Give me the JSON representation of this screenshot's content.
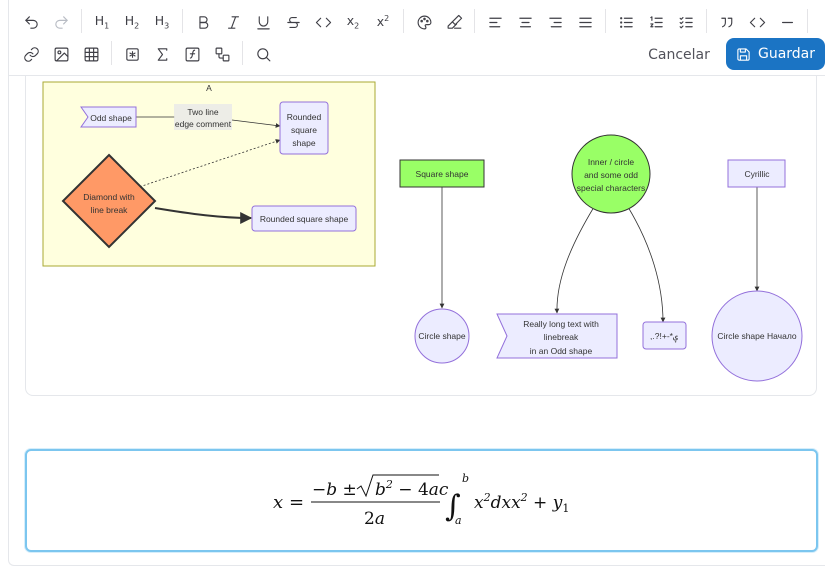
{
  "toolbar": {
    "row1": [
      {
        "name": "undo-icon",
        "enabled": true
      },
      {
        "name": "redo-icon",
        "enabled": false
      },
      {
        "name": "heading-1-button",
        "label": "H1"
      },
      {
        "name": "heading-2-button",
        "label": "H2"
      },
      {
        "name": "heading-3-button",
        "label": "H3"
      },
      {
        "name": "bold-icon"
      },
      {
        "name": "italic-icon"
      },
      {
        "name": "underline-icon"
      },
      {
        "name": "strikethrough-icon"
      },
      {
        "name": "code-icon"
      },
      {
        "name": "subscript-icon",
        "label": "x₂"
      },
      {
        "name": "superscript-icon",
        "label": "x²"
      },
      {
        "name": "palette-icon"
      },
      {
        "name": "highlighter-icon"
      },
      {
        "name": "align-left-icon"
      },
      {
        "name": "align-center-icon"
      },
      {
        "name": "align-right-icon"
      },
      {
        "name": "align-justify-icon"
      },
      {
        "name": "bullet-list-icon"
      },
      {
        "name": "ordered-list-icon"
      },
      {
        "name": "task-list-icon"
      },
      {
        "name": "blockquote-icon"
      },
      {
        "name": "code-block-icon"
      },
      {
        "name": "horizontal-rule-icon"
      }
    ],
    "row2": [
      {
        "name": "link-icon"
      },
      {
        "name": "image-icon"
      },
      {
        "name": "table-icon"
      },
      {
        "name": "embed-icon"
      },
      {
        "name": "sigma-icon"
      },
      {
        "name": "function-icon"
      },
      {
        "name": "diagram-icon"
      },
      {
        "name": "search-icon"
      }
    ],
    "cancel_label": "Cancelar",
    "save_label": "Guardar",
    "accent": "#1b74c4"
  },
  "diagram": {
    "subgraph_title": "A",
    "nodes": {
      "odd_shape": "Odd shape",
      "edge_comment_line1": "Two line",
      "edge_comment_line2": "edge comment",
      "rounded_line1": "Rounded",
      "rounded_line2": "square",
      "rounded_line3": "shape",
      "diamond_line1": "Diamond with",
      "diamond_line2": "line break",
      "rounded_square_shape": "Rounded square shape",
      "square_shape": "Square shape",
      "inner_circle_line1": "Inner / circle",
      "inner_circle_line2": "and some odd",
      "inner_circle_line3": "special characters",
      "cyrillic": "Cyrillic",
      "circle_shape": "Circle shape",
      "long_text_line1": "Really long text with",
      "long_text_line2": "linebreak",
      "long_text_line3": "in an Odd shape",
      "special_chars": ",.?!+-*ؠ",
      "circle_cyrillic": "Circle shape Начало"
    },
    "colors": {
      "subgraph_fill": "#ffffde",
      "subgraph_stroke": "#aaaa33",
      "node_fill": "#ececff",
      "node_stroke": "#9370db",
      "diamond_fill": "#ff9966",
      "green_fill": "#99ff66"
    }
  },
  "formula": {
    "latex": "x = \\frac{-b \\pm \\sqrt{b^2 - 4ac}}{2a} \\int_a^b x^2 dx x^2 + y_1"
  }
}
